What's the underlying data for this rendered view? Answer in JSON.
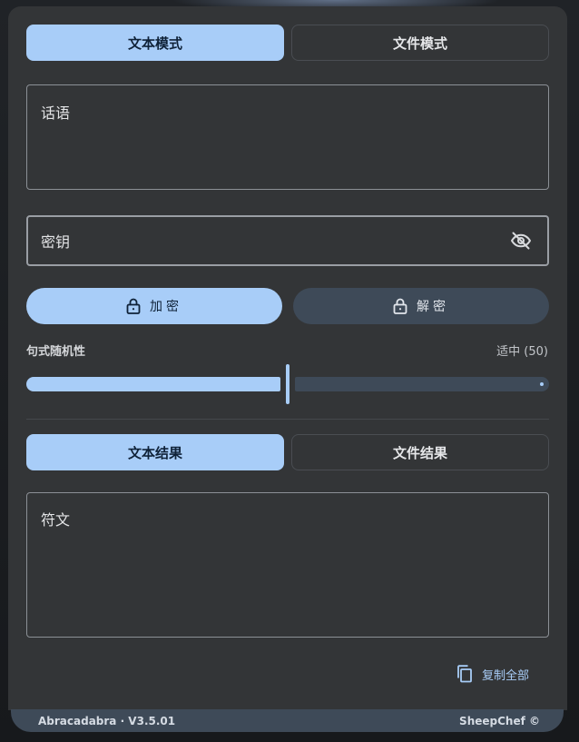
{
  "mode_tabs": {
    "text_mode": "文本模式",
    "file_mode": "文件模式"
  },
  "input": {
    "placeholder": "话语"
  },
  "key": {
    "placeholder": "密钥",
    "toggle_icon": "eye-off-icon"
  },
  "actions": {
    "encrypt": "加密",
    "decrypt": "解密",
    "lock_icon": "lock-icon"
  },
  "slider": {
    "label": "句式随机性",
    "value_text": "适中 (50)",
    "value": 50,
    "min": 0,
    "max": 100
  },
  "result_tabs": {
    "text_result": "文本结果",
    "file_result": "文件结果"
  },
  "output": {
    "placeholder": "符文"
  },
  "copy": {
    "label": "复制全部",
    "icon": "copy-icon"
  },
  "footer": {
    "app_version": "Abracadabra · V3.5.01",
    "author": "SheepChef ©"
  },
  "colors": {
    "accent": "#a8cdf8",
    "surface": "#333537",
    "secondary": "#3e4a58"
  }
}
